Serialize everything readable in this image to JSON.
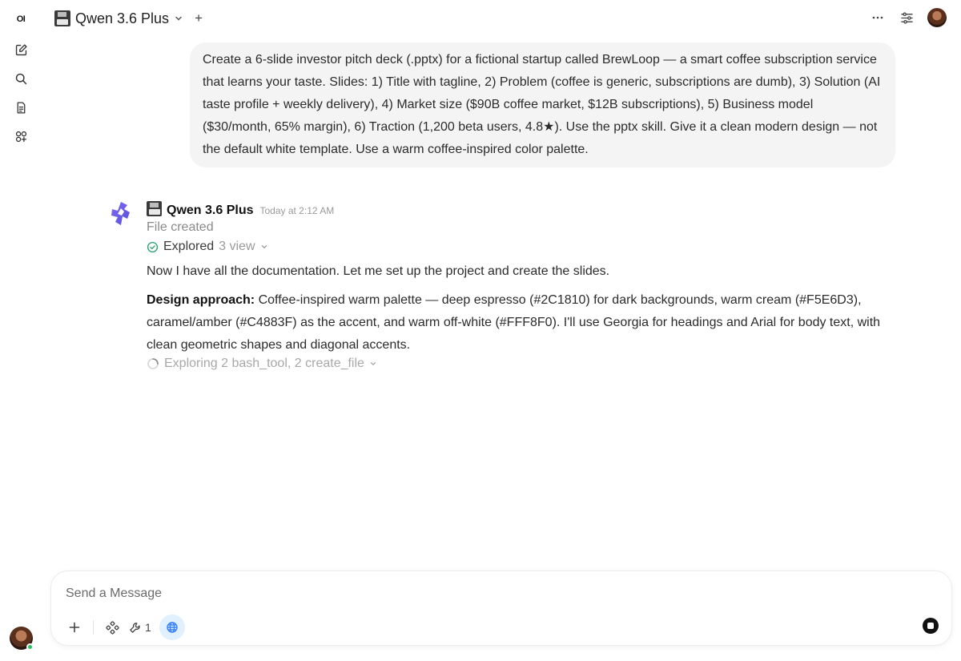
{
  "rail": {
    "logo_text": "OI",
    "items": [
      {
        "icon": "new-chat-icon"
      },
      {
        "icon": "search-icon"
      },
      {
        "icon": "notes-icon"
      },
      {
        "icon": "workspace-icon"
      }
    ]
  },
  "header": {
    "model_name": "Qwen 3.6 Plus",
    "add_label": "+"
  },
  "user_message": {
    "text": "Create a 6-slide investor pitch deck (.pptx) for a fictional startup called BrewLoop — a smart coffee subscription service that learns your taste. Slides: 1) Title with tagline, 2) Problem (coffee is generic, subscriptions are dumb), 3) Solution (AI taste profile + weekly delivery), 4) Market size ($90B coffee market, $12B subscriptions), 5) Business model ($30/month, 65% margin), 6) Traction (1,200 beta users, 4.8★). Use the pptx skill. Give it a clean modern design — not the default white template. Use a warm coffee-inspired color palette."
  },
  "assistant": {
    "name": "Qwen 3.6 Plus",
    "timestamp": "Today at 2:12 AM",
    "status": "File created",
    "explored_label": "Explored",
    "explored_count": "3 view",
    "paragraph1": "Now I have all the documentation. Let me set up the project and create the slides.",
    "design_label": "Design approach:",
    "design_text": " Coffee-inspired warm palette — deep espresso (#2C1810) for dark backgrounds, warm cream (#F5E6D3), caramel/amber (#C4883F) as the accent, and warm off-white (#FFF8F0). I'll use Georgia for headings and Arial for body text, with clean geometric shapes and diagonal accents.",
    "exploring_label": "Exploring 2 bash_tool, 2 create_file"
  },
  "composer": {
    "placeholder": "Send a Message",
    "tool_count": "1"
  },
  "colors": {
    "accent_blue": "#3b82f6",
    "web_bg": "#e0f0fd",
    "online": "#22c55e",
    "bubble": "#f4f4f5"
  }
}
